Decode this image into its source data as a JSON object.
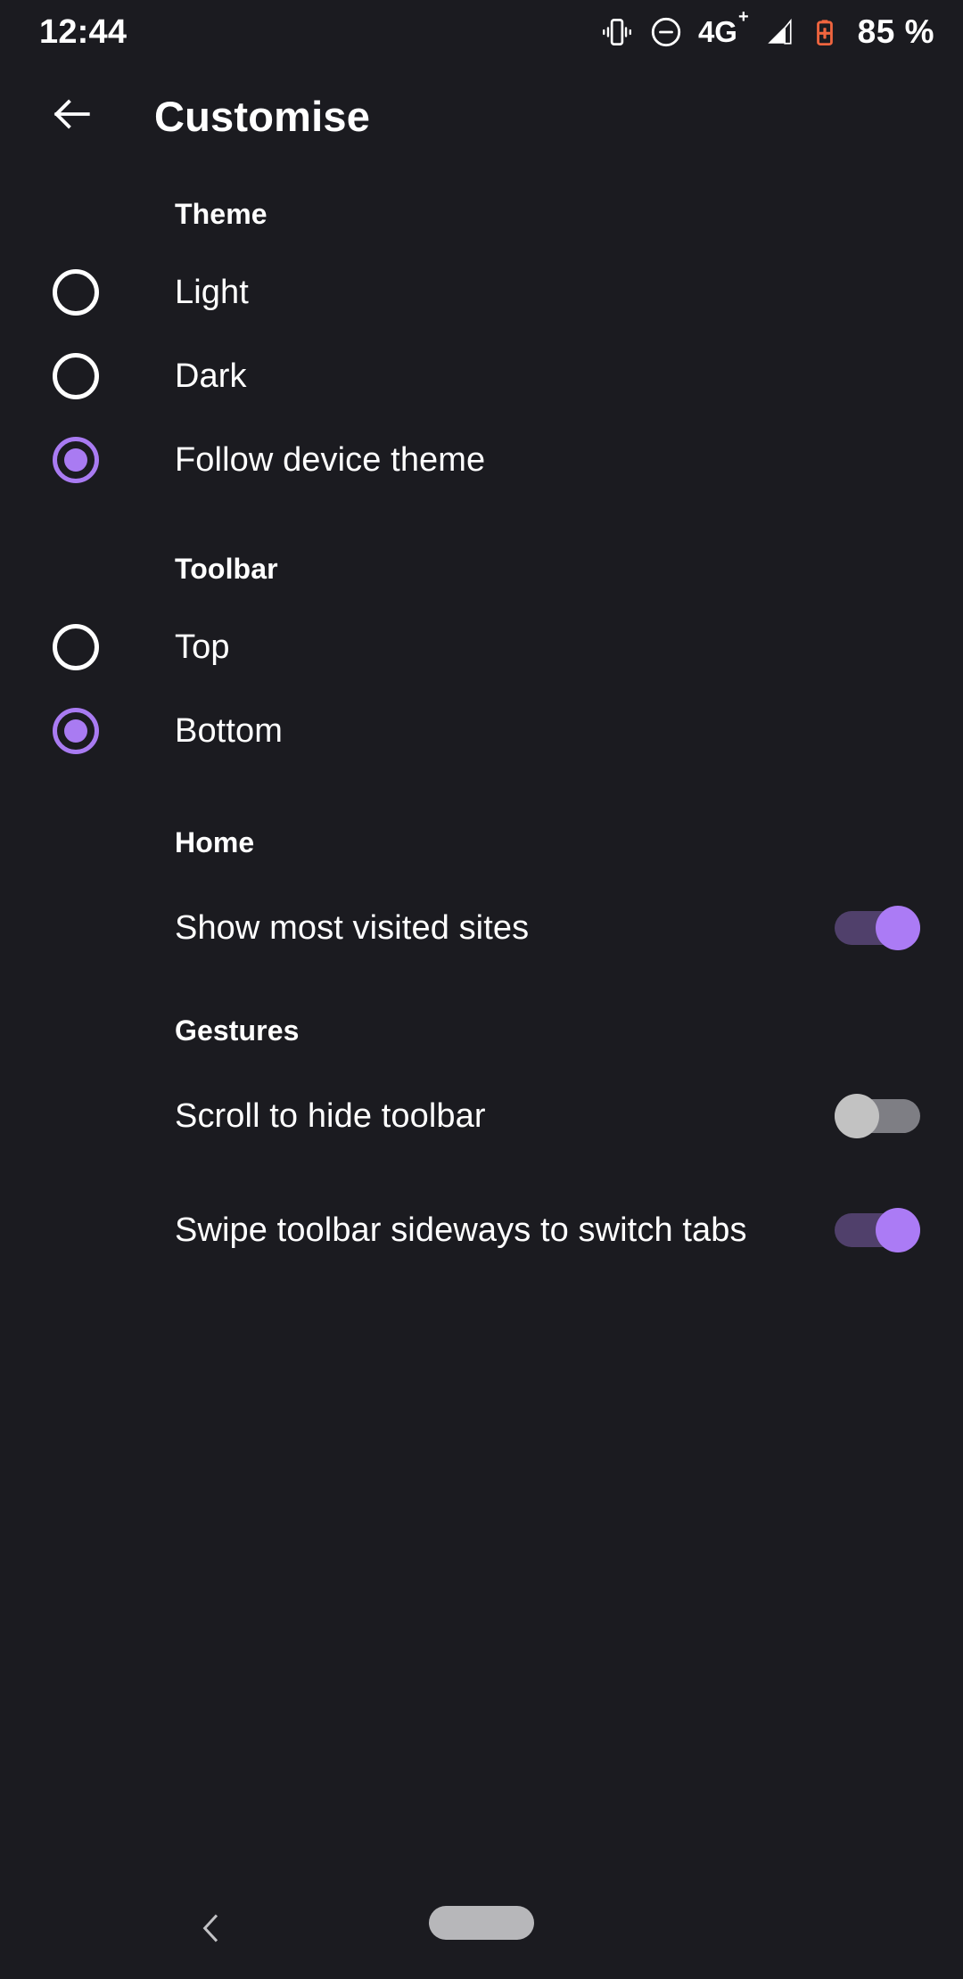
{
  "status_bar": {
    "time": "12:44",
    "icons": [
      "vibrate-icon",
      "do-not-disturb-icon",
      "signal-bars-icon",
      "battery-saver-icon"
    ],
    "network_label": "4G",
    "network_plus": "+",
    "battery_percent": "85 %"
  },
  "app_bar": {
    "back_icon": "arrow-left-icon",
    "title": "Customise"
  },
  "sections": {
    "theme": {
      "header": "Theme",
      "options": [
        {
          "label": "Light",
          "selected": false
        },
        {
          "label": "Dark",
          "selected": false
        },
        {
          "label": "Follow device theme",
          "selected": true
        }
      ]
    },
    "toolbar": {
      "header": "Toolbar",
      "options": [
        {
          "label": "Top",
          "selected": false
        },
        {
          "label": "Bottom",
          "selected": true
        }
      ]
    },
    "home": {
      "header": "Home",
      "switches": [
        {
          "label": "Show most visited sites",
          "on": true
        }
      ]
    },
    "gestures": {
      "header": "Gestures",
      "switches": [
        {
          "label": "Scroll to hide toolbar",
          "on": false
        },
        {
          "label": "Swipe toolbar sideways to switch tabs",
          "on": true
        }
      ]
    }
  },
  "nav_bar": {
    "back_icon": "chevron-left-icon",
    "home_pill": "home-pill-handle"
  },
  "colors": {
    "background": "#1b1b20",
    "accent_purple": "#a97bf2",
    "switch_thumb_on": "#ab7bf5",
    "switch_track_on": "#50406b",
    "switch_thumb_off": "#c2c2c2",
    "switch_track_off": "#7e7e84",
    "battery_saver": "#f0653f",
    "text_primary": "#ffffff"
  }
}
